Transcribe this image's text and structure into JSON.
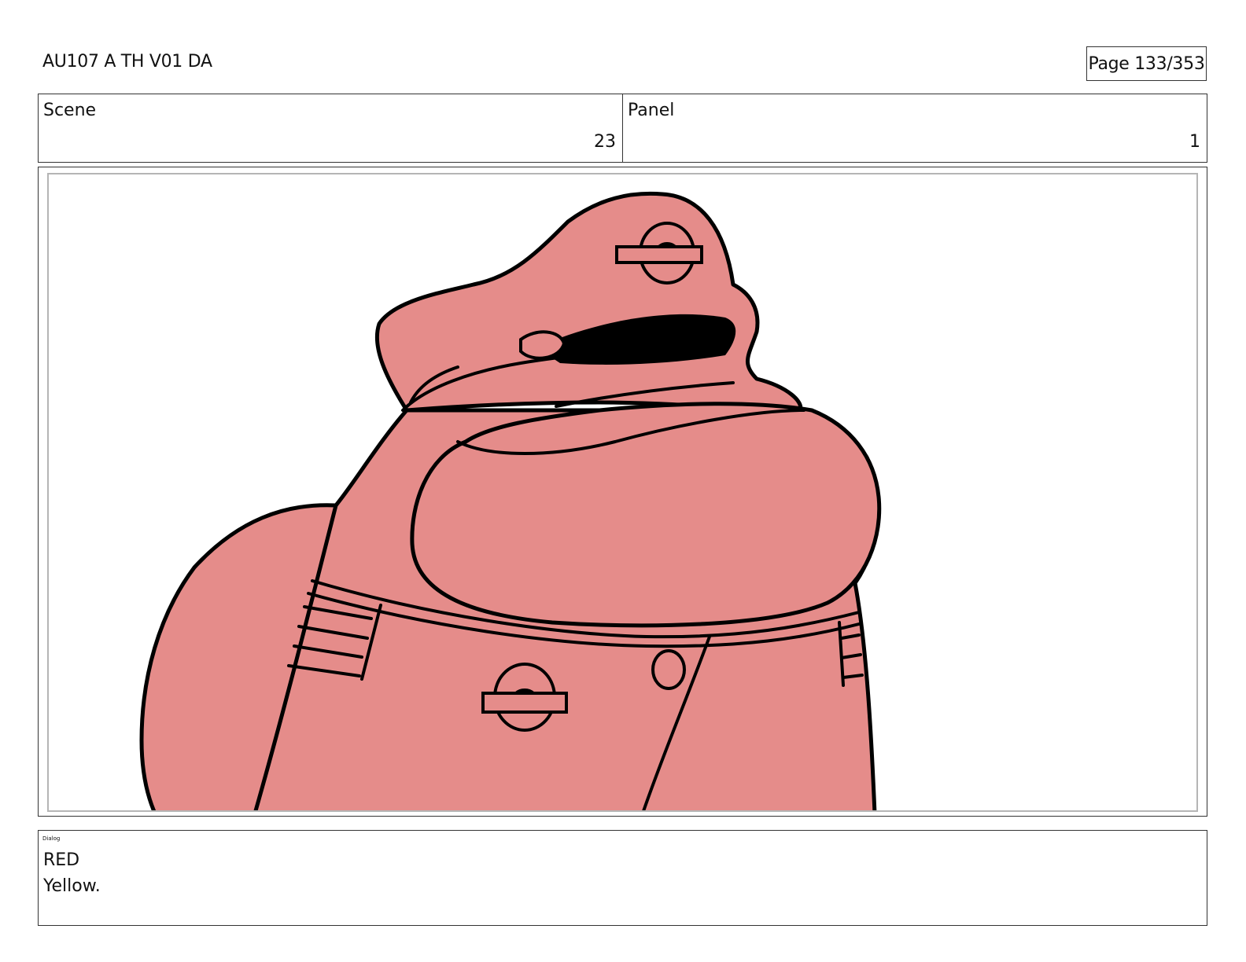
{
  "header": {
    "title": "AU107 A TH V01 DA",
    "page": "Page 133/353"
  },
  "info": {
    "scene_label": "Scene",
    "scene_value": "23",
    "panel_label": "Panel",
    "panel_value": "1"
  },
  "artwork": {
    "description_icon": "pink-character-illustration",
    "body_color": "#e58c8a",
    "line_color": "#000000"
  },
  "dialog": {
    "label": "Dialog",
    "speaker": "RED",
    "line": "Yellow."
  }
}
